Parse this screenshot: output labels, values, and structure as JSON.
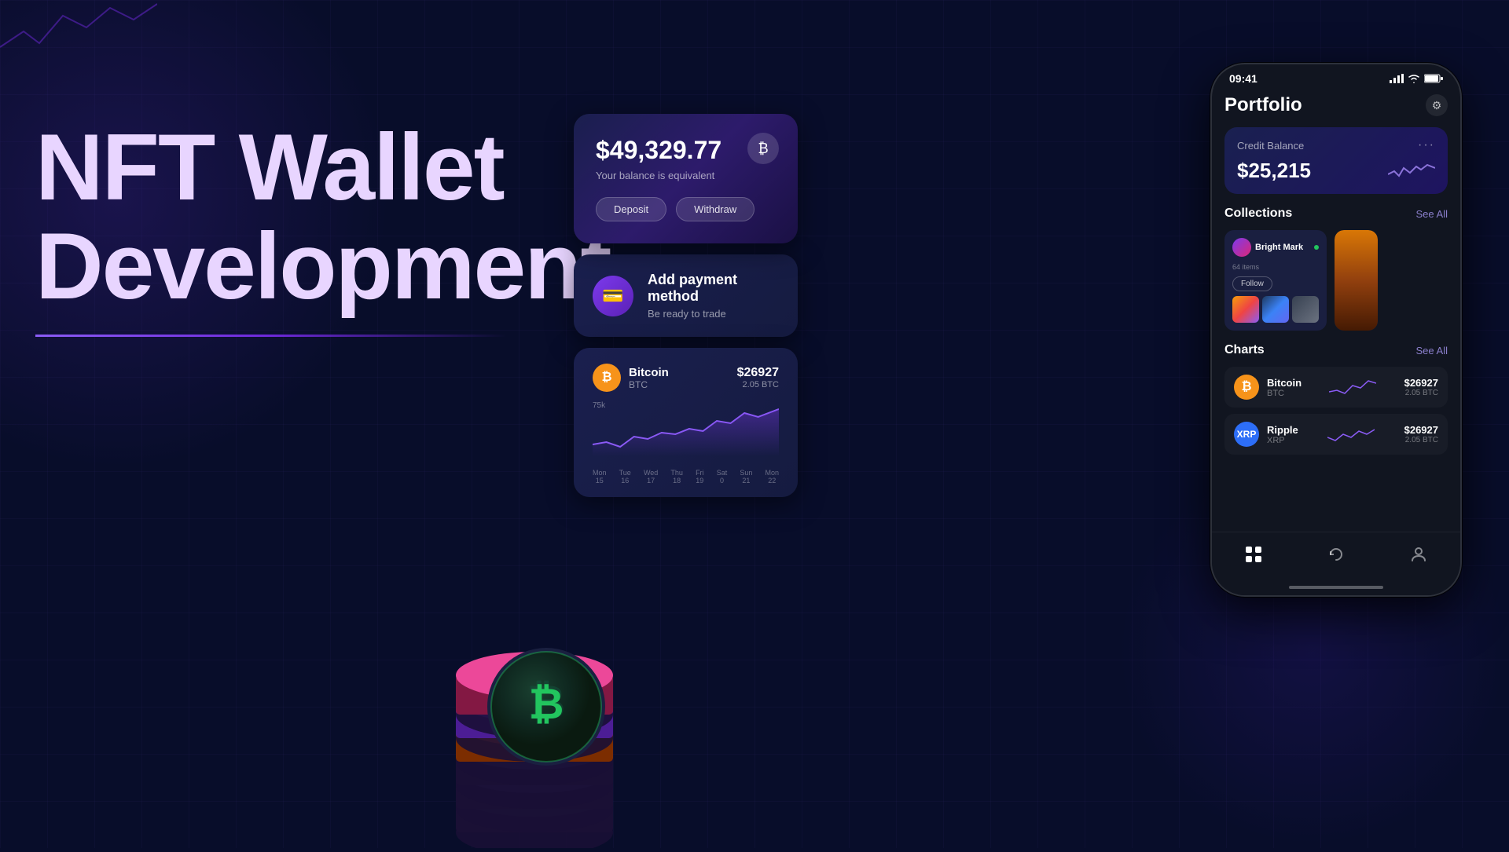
{
  "background": {
    "color": "#080d2a"
  },
  "hero": {
    "line1": "NFT Wallet",
    "line2": "Development"
  },
  "balance_card": {
    "amount": "$49,329.77",
    "subtitle": "Your balance is equivalent",
    "deposit_btn": "Deposit",
    "withdraw_btn": "Withdraw"
  },
  "payment_card": {
    "title": "Add payment method",
    "subtitle": "Be ready to trade"
  },
  "btc_card": {
    "name": "Bitcoin",
    "ticker": "BTC",
    "price": "$26927",
    "price_sub": "2.05 BTC",
    "chart_label": "75k",
    "dates": [
      "Mon 15",
      "Tue 16",
      "Wed 17",
      "Thu 18",
      "Fri 19",
      "Sat 0",
      "Sun 21",
      "Mon 22"
    ]
  },
  "phone": {
    "time": "09:41",
    "title": "Portfolio",
    "credit": {
      "label": "Credit Balance",
      "amount": "$25,215"
    },
    "collections": {
      "title": "Collections",
      "see_all": "See All",
      "item": {
        "name": "Bright Mark",
        "items_count": "64 items",
        "follow_btn": "Follow"
      }
    },
    "charts": {
      "title": "Charts",
      "see_all": "See All",
      "items": [
        {
          "name": "Bitcoin",
          "ticker": "BTC",
          "price": "$26927",
          "price_sub": "2.05 BTC"
        },
        {
          "name": "Ripple",
          "ticker": "XRP",
          "price": "$26927",
          "price_sub": "2.05 BTC"
        }
      ]
    },
    "nav": {
      "items": [
        "grid",
        "refresh",
        "user"
      ]
    }
  }
}
